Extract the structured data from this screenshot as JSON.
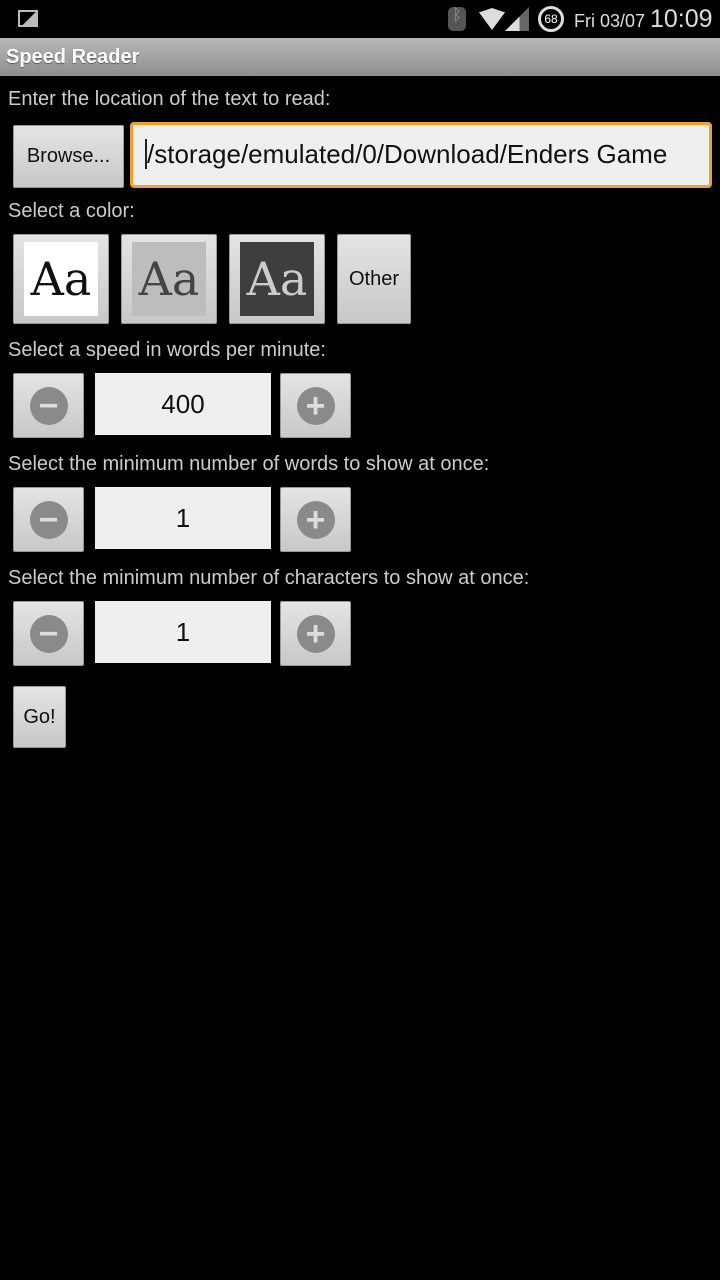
{
  "status": {
    "day_date": "Fri 03/07",
    "time": "10:09",
    "battery": "68",
    "icons": [
      "image-icon",
      "bluetooth-icon",
      "wifi-icon",
      "signal-icon",
      "battery-icon"
    ]
  },
  "app": {
    "title": "Speed Reader"
  },
  "location": {
    "label": "Enter the location of the text to read:",
    "browse": "Browse...",
    "value": "/storage/emulated/0/Download/Enders Game"
  },
  "color": {
    "label": "Select a color:",
    "swatch_text": "Aa",
    "other": "Other"
  },
  "speed": {
    "label": "Select a speed in words per minute:",
    "value": "400"
  },
  "words": {
    "label": "Select the minimum number of words to show at once:",
    "value": "1"
  },
  "chars": {
    "label": "Select the minimum number of characters to show at once:",
    "value": "1"
  },
  "go": "Go!",
  "accent": "#f0a030"
}
